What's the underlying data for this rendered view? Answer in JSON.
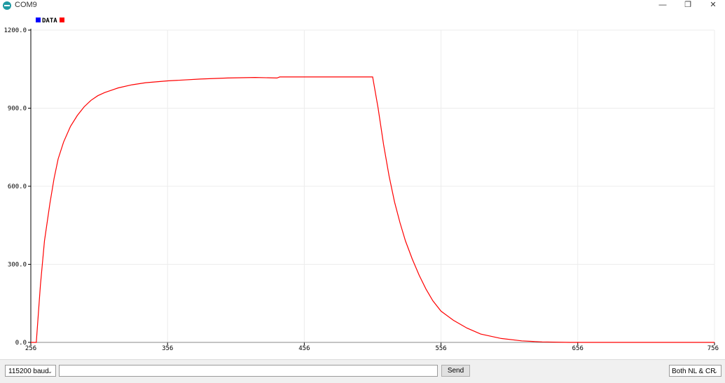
{
  "window": {
    "title": "COM9",
    "minimize_glyph": "—",
    "maximize_glyph": "❐",
    "close_glyph": "✕",
    "icon": "arduino-icon"
  },
  "bottom_bar": {
    "baud_value": "115200 baud",
    "input_value": "",
    "send_label": "Send",
    "line_ending_value": "Both NL & CR"
  },
  "colors": {
    "series": "#ff0000",
    "legend_blue": "#0000ff",
    "grid": "#ececec",
    "axis": "#000000"
  },
  "chart_data": {
    "type": "line",
    "title": "",
    "xlabel": "",
    "ylabel": "",
    "xlim": [
      256,
      756
    ],
    "ylim": [
      0,
      1200
    ],
    "x_ticks": [
      "256",
      "356",
      "456",
      "556",
      "656",
      "756"
    ],
    "y_ticks": [
      "0.0",
      "300.0",
      "600.0",
      "900.0",
      "1200.0"
    ],
    "grid": true,
    "legend": {
      "position": "top-left",
      "entries": [
        "DATA"
      ]
    },
    "series": [
      {
        "name": "DATA",
        "x": [
          256,
          260,
          263,
          266,
          270,
          273,
          276,
          280,
          285,
          290,
          295,
          300,
          305,
          310,
          320,
          330,
          340,
          356,
          380,
          400,
          420,
          436,
          438,
          440,
          460,
          480,
          506,
          510,
          514,
          518,
          522,
          526,
          530,
          535,
          540,
          545,
          550,
          556,
          565,
          575,
          585,
          600,
          615,
          630,
          650,
          656,
          660,
          700,
          756
        ],
        "y": [
          0,
          0,
          220,
          390,
          535,
          630,
          705,
          770,
          830,
          872,
          905,
          930,
          948,
          960,
          978,
          990,
          998,
          1005,
          1012,
          1016,
          1018,
          1016,
          1020,
          1020,
          1020,
          1020,
          1020,
          900,
          760,
          640,
          540,
          460,
          390,
          320,
          258,
          205,
          160,
          120,
          85,
          55,
          32,
          15,
          6,
          2,
          0,
          0,
          0,
          0,
          0
        ]
      }
    ]
  }
}
